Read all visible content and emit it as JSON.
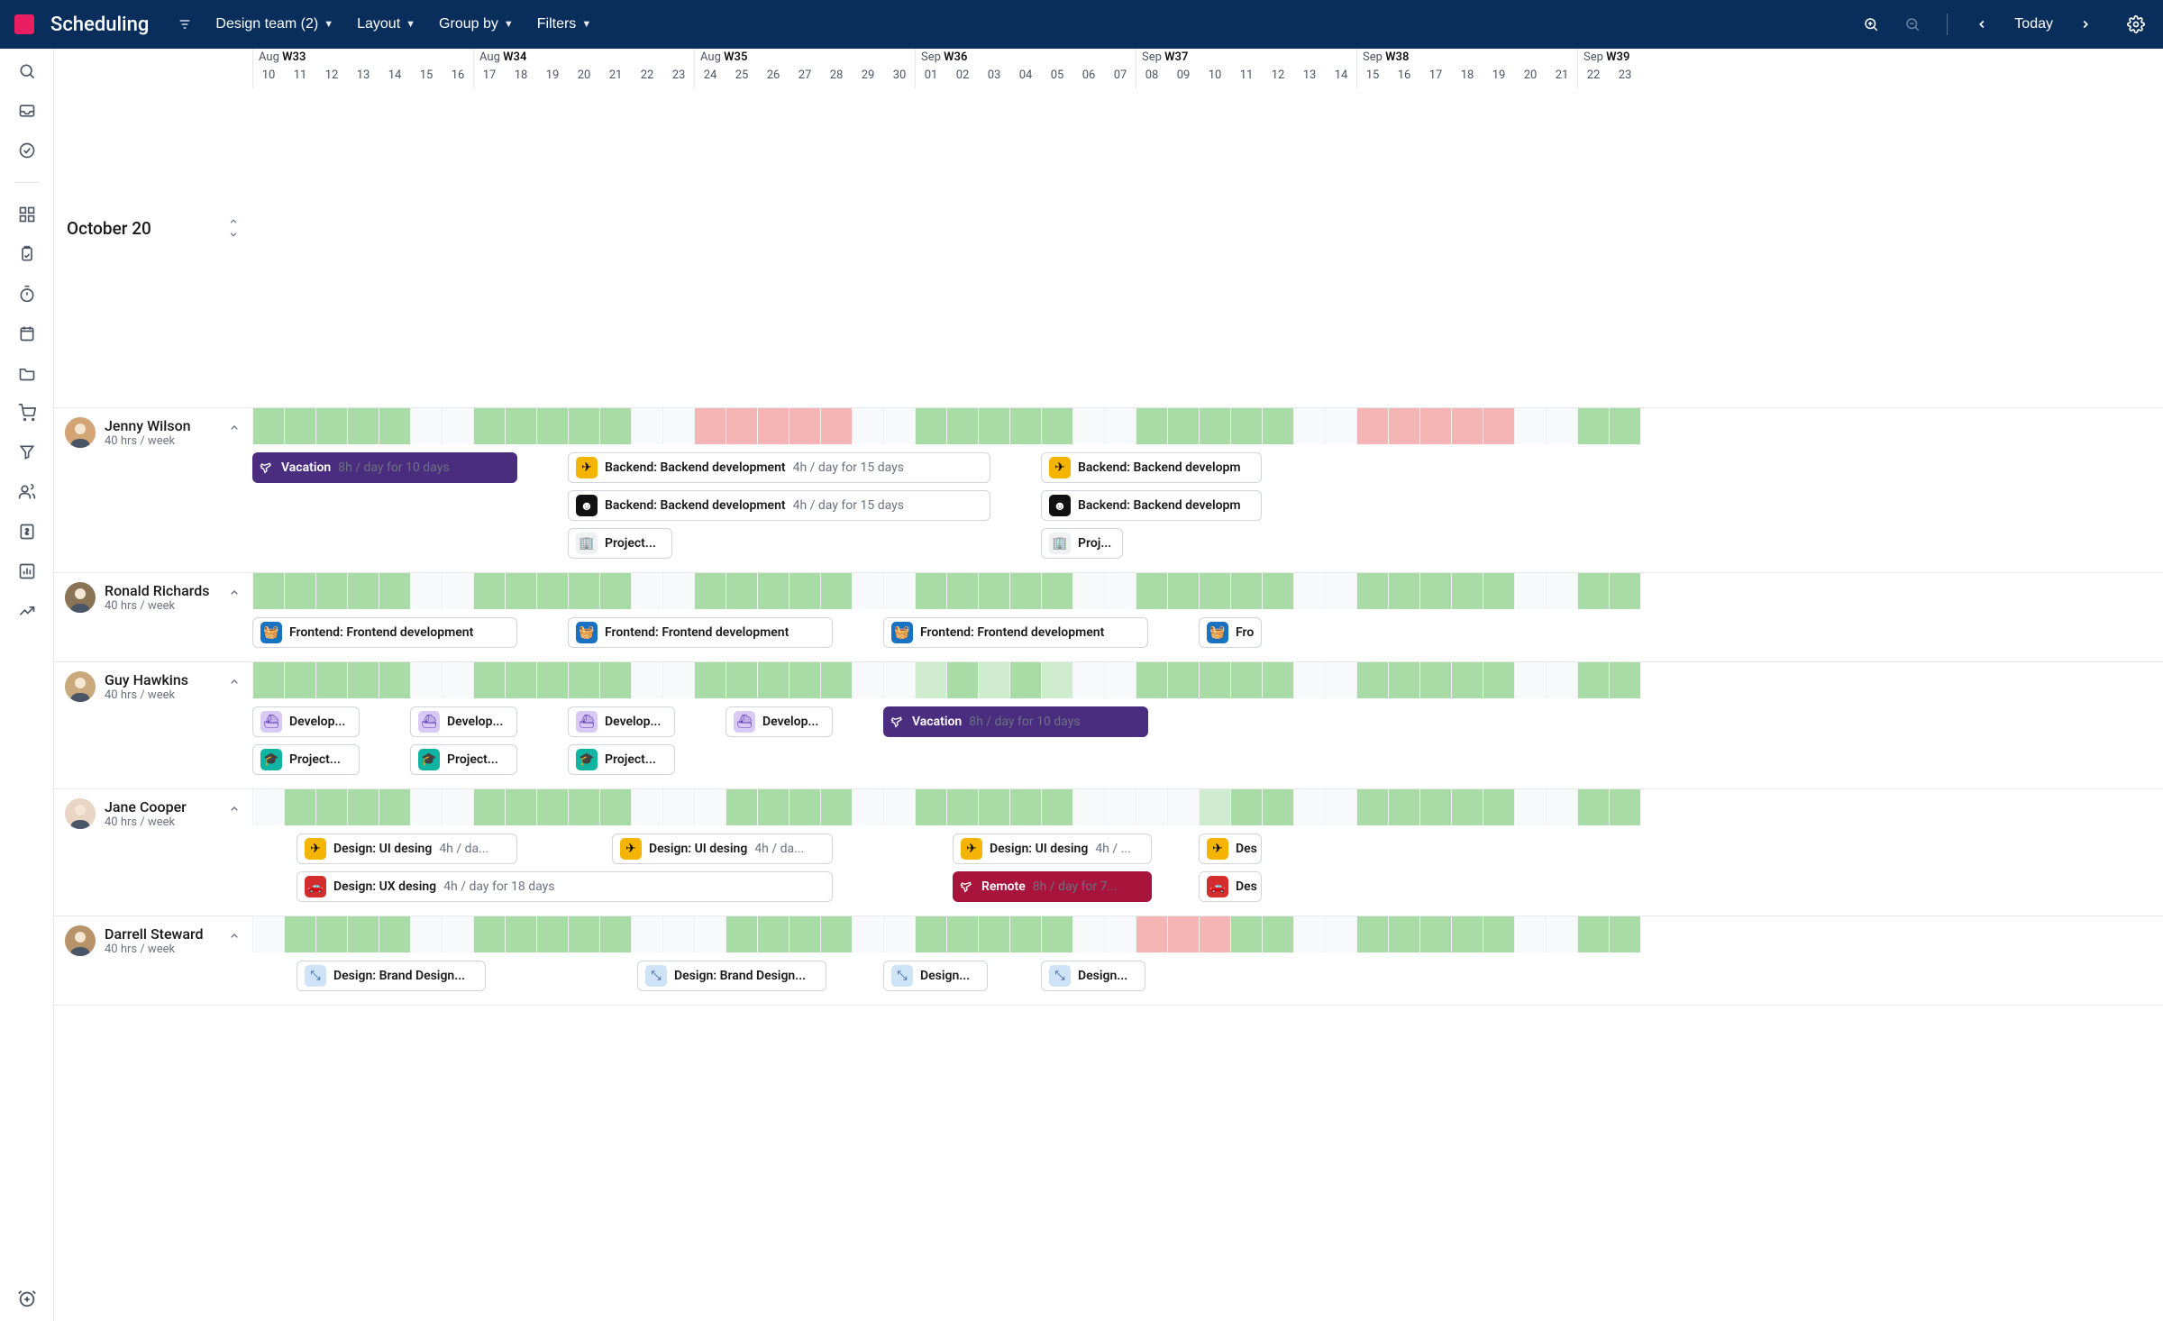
{
  "header": {
    "title": "Scheduling",
    "team_filter": "Design team (2)",
    "layout_label": "Layout",
    "groupby_label": "Group by",
    "filters_label": "Filters",
    "today_label": "Today"
  },
  "date_corner": "October 20",
  "weeks": [
    {
      "month": "Aug",
      "week": "W33",
      "days": [
        "10",
        "11",
        "12",
        "13",
        "14"
      ],
      "weekend": [
        "15",
        "16"
      ]
    },
    {
      "month": "Aug",
      "week": "W34",
      "days": [
        "17",
        "18",
        "19",
        "20",
        "21"
      ],
      "weekend": [
        "22",
        "23"
      ]
    },
    {
      "month": "Aug",
      "week": "W35",
      "days": [
        "24",
        "25",
        "26",
        "27",
        "28"
      ],
      "weekend": [
        "29",
        "30"
      ]
    },
    {
      "month": "Sep",
      "week": "W36",
      "days": [
        "01",
        "02",
        "03",
        "04",
        "05"
      ],
      "weekend": [
        "06",
        "07"
      ]
    },
    {
      "month": "Sep",
      "week": "W37",
      "days": [
        "08",
        "09",
        "10",
        "11",
        "12"
      ],
      "weekend": [
        "13",
        "14"
      ]
    },
    {
      "month": "Sep",
      "week": "W38",
      "days": [
        "15",
        "16",
        "17",
        "18",
        "19"
      ],
      "weekend": [
        "20",
        "21"
      ]
    },
    {
      "month": "Sep",
      "week": "W39",
      "days": [
        "22",
        "23"
      ],
      "weekend": []
    }
  ],
  "people": [
    {
      "name": "Jenny Wilson",
      "subtitle": "40 hrs / week",
      "util": [
        "green",
        "green",
        "green",
        "green",
        "green",
        "blank",
        "blank",
        "green",
        "green",
        "green",
        "green",
        "green",
        "blank",
        "blank",
        "red",
        "red",
        "red",
        "red",
        "red",
        "blank",
        "blank",
        "green",
        "green",
        "green",
        "green",
        "green",
        "blank",
        "blank",
        "green",
        "green",
        "green",
        "green",
        "green",
        "blank",
        "blank",
        "red",
        "red",
        "red",
        "red",
        "red",
        "blank",
        "blank",
        "green",
        "green"
      ],
      "rows": [
        [
          {
            "start": 0,
            "span": 84,
            "style": "solid purple",
            "icon": "leave",
            "label": "Vacation",
            "meta": "8h / day for 10 days"
          },
          {
            "start": 100,
            "span": 134,
            "icon": "plane",
            "badge": "yellow",
            "label": "Backend: Backend development",
            "meta": "4h / day for 15 days"
          },
          {
            "start": 250,
            "span": 70,
            "icon": "plane",
            "badge": "yellow",
            "label": "Backend: Backend developm"
          }
        ],
        [
          {
            "start": 100,
            "span": 134,
            "icon": "face",
            "badge": "black",
            "label": "Backend: Backend development",
            "meta": "4h / day for 15 days"
          },
          {
            "start": 250,
            "span": 70,
            "icon": "face",
            "badge": "black",
            "label": "Backend: Backend developm"
          }
        ],
        [
          {
            "start": 100,
            "span": 33,
            "icon": "building",
            "badge": "grey",
            "label": "Project..."
          },
          {
            "start": 250,
            "span": 26,
            "icon": "building",
            "badge": "grey",
            "label": "Proj..."
          }
        ]
      ]
    },
    {
      "name": "Ronald Richards",
      "subtitle": "40 hrs / week",
      "util": [
        "green",
        "green",
        "green",
        "green",
        "green",
        "blank",
        "blank",
        "green",
        "green",
        "green",
        "green",
        "green",
        "blank",
        "blank",
        "green",
        "green",
        "green",
        "green",
        "green",
        "blank",
        "blank",
        "green",
        "green",
        "green",
        "green",
        "green",
        "blank",
        "blank",
        "green",
        "green",
        "green",
        "green",
        "green",
        "blank",
        "blank",
        "green",
        "green",
        "green",
        "green",
        "green",
        "blank",
        "blank",
        "green",
        "green"
      ],
      "rows": [
        [
          {
            "start": 0,
            "span": 84,
            "icon": "basket",
            "badge": "blue",
            "label": "Frontend: Frontend development"
          },
          {
            "start": 100,
            "span": 84,
            "icon": "basket",
            "badge": "blue",
            "label": "Frontend: Frontend development"
          },
          {
            "start": 200,
            "span": 84,
            "icon": "basket",
            "badge": "blue",
            "label": "Frontend: Frontend development"
          },
          {
            "start": 300,
            "span": 20,
            "icon": "basket",
            "badge": "blue",
            "label": "Fro"
          }
        ]
      ]
    },
    {
      "name": "Guy Hawkins",
      "subtitle": "40 hrs / week",
      "util": [
        "green",
        "green",
        "green",
        "green",
        "green",
        "blank",
        "blank",
        "green",
        "green",
        "green",
        "green",
        "green",
        "blank",
        "blank",
        "green",
        "green",
        "green",
        "green",
        "green",
        "blank",
        "blank",
        "lightgreen",
        "green",
        "lightgreen",
        "green",
        "lightgreen",
        "blank",
        "blank",
        "green",
        "green",
        "green",
        "green",
        "green",
        "blank",
        "blank",
        "green",
        "green",
        "green",
        "green",
        "green",
        "blank",
        "blank",
        "green",
        "green"
      ],
      "rows": [
        [
          {
            "start": 0,
            "span": 34,
            "icon": "ship",
            "badge": "lav",
            "label": "Develop..."
          },
          {
            "start": 50,
            "span": 34,
            "icon": "ship",
            "badge": "lav",
            "label": "Develop..."
          },
          {
            "start": 100,
            "span": 34,
            "icon": "ship",
            "badge": "lav",
            "label": "Develop..."
          },
          {
            "start": 150,
            "span": 34,
            "icon": "ship",
            "badge": "lav",
            "label": "Develop..."
          },
          {
            "start": 200,
            "span": 84,
            "style": "solid purple",
            "icon": "leave",
            "label": "Vacation",
            "meta": "8h / day for 10 days"
          }
        ],
        [
          {
            "start": 0,
            "span": 34,
            "icon": "grad",
            "badge": "teal",
            "label": "Project..."
          },
          {
            "start": 50,
            "span": 34,
            "icon": "grad",
            "badge": "teal",
            "label": "Project..."
          },
          {
            "start": 100,
            "span": 34,
            "icon": "grad",
            "badge": "teal",
            "label": "Project..."
          }
        ]
      ]
    },
    {
      "name": "Jane Cooper",
      "subtitle": "40 hrs / week",
      "util": [
        "blank",
        "green",
        "green",
        "green",
        "green",
        "blank",
        "blank",
        "green",
        "green",
        "green",
        "green",
        "green",
        "blank",
        "blank",
        "blank",
        "green",
        "green",
        "green",
        "green",
        "blank",
        "blank",
        "green",
        "green",
        "green",
        "green",
        "green",
        "blank",
        "blank",
        "blank",
        "blank",
        "lightgreen",
        "green",
        "green",
        "blank",
        "blank",
        "green",
        "green",
        "green",
        "green",
        "green",
        "blank",
        "blank",
        "green",
        "green"
      ],
      "rows": [
        [
          {
            "start": 14,
            "span": 70,
            "icon": "plane",
            "badge": "yellow",
            "label": "Design: UI desing",
            "meta": "4h / da..."
          },
          {
            "start": 114,
            "span": 70,
            "icon": "plane",
            "badge": "yellow",
            "label": "Design: UI desing",
            "meta": "4h / da..."
          },
          {
            "start": 222,
            "span": 63,
            "icon": "plane",
            "badge": "yellow",
            "label": "Design: UI desing",
            "meta": "4h / ..."
          },
          {
            "start": 300,
            "span": 20,
            "icon": "plane",
            "badge": "yellow",
            "label": "Des"
          }
        ],
        [
          {
            "start": 14,
            "span": 170,
            "icon": "car",
            "badge": "red",
            "label": "Design: UX desing",
            "meta": "4h / day for 18 days"
          },
          {
            "start": 222,
            "span": 63,
            "style": "solid crimson",
            "icon": "remote",
            "label": "Remote",
            "meta": "8h / day for 7..."
          },
          {
            "start": 300,
            "span": 20,
            "icon": "car",
            "badge": "red",
            "label": "Des"
          }
        ]
      ]
    },
    {
      "name": "Darrell Steward",
      "subtitle": "40 hrs / week",
      "util": [
        "blank",
        "green",
        "green",
        "green",
        "green",
        "blank",
        "blank",
        "green",
        "green",
        "green",
        "green",
        "green",
        "blank",
        "blank",
        "blank",
        "green",
        "green",
        "green",
        "green",
        "blank",
        "blank",
        "green",
        "green",
        "green",
        "green",
        "green",
        "blank",
        "blank",
        "red",
        "red",
        "red",
        "green",
        "green",
        "blank",
        "blank",
        "green",
        "green",
        "green",
        "green",
        "green",
        "blank",
        "blank",
        "green",
        "green"
      ],
      "rows": [
        [
          {
            "start": 14,
            "span": 60,
            "icon": "arrows",
            "badge": "lblue",
            "label": "Design: Brand Design..."
          },
          {
            "start": 122,
            "span": 60,
            "icon": "arrows",
            "badge": "lblue",
            "label": "Design: Brand Design..."
          },
          {
            "start": 200,
            "span": 33,
            "icon": "arrows",
            "badge": "lblue",
            "label": "Design..."
          },
          {
            "start": 250,
            "span": 33,
            "icon": "arrows",
            "badge": "lblue",
            "label": "Design..."
          }
        ]
      ]
    }
  ],
  "icons": {
    "leave": "✈",
    "plane": "✈",
    "face": "☻",
    "building": "🏢",
    "basket": "🧺",
    "ship": "⛴",
    "grad": "🎓",
    "car": "🚗",
    "remote": "⤢",
    "arrows": "⤡"
  }
}
